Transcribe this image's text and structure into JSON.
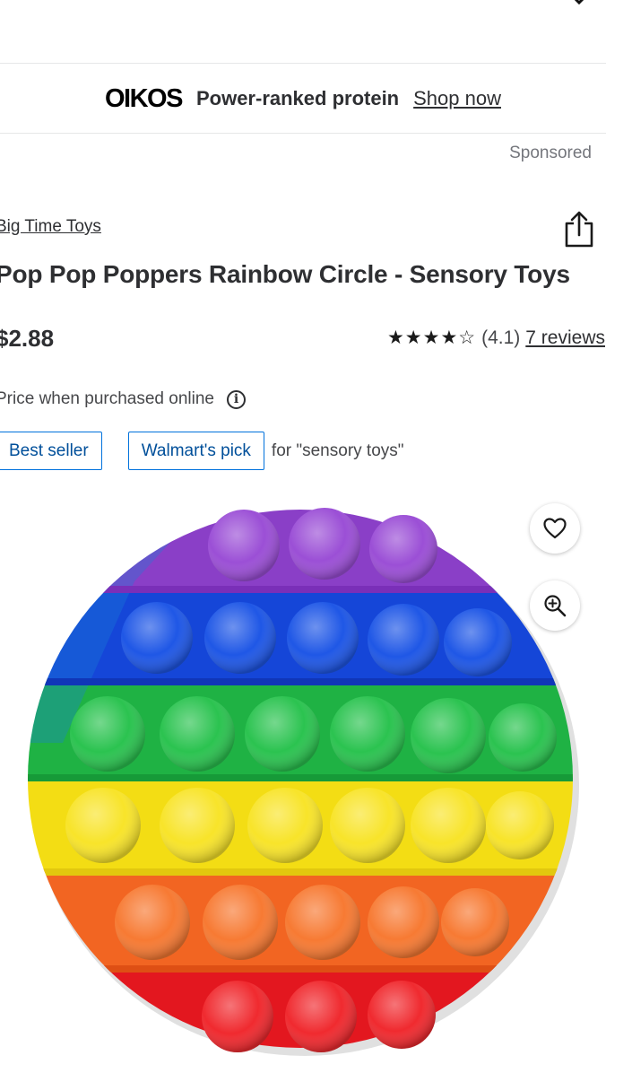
{
  "ad": {
    "brand": "OIKOS",
    "tagline": "Power-ranked protein",
    "cta": "Shop now",
    "sponsored_label": "Sponsored"
  },
  "product": {
    "brand": "Big Time Toys",
    "title": "Pop Pop Poppers Rainbow Circle - Sensory Toys",
    "price": "$2.88",
    "price_note": "Price when purchased online",
    "rating": {
      "value": 4.1,
      "stars_filled": 4,
      "stars_total": 5,
      "label": "(4.1)",
      "reviews_label": "7 reviews"
    },
    "badges": {
      "best_seller": "Best seller",
      "pick": "Walmart's pick",
      "context": "for \"sensory toys\""
    }
  },
  "icons": {
    "close": "close-icon",
    "share": "share-icon",
    "info": "info-icon",
    "favorite": "heart-icon",
    "zoom": "zoom-in-icon"
  },
  "colors": {
    "text": "#2e2f32",
    "badge_blue": "#0071dc",
    "rainbow": [
      "#8a3fc7",
      "#1546d8",
      "#1fb244",
      "#f3dd14",
      "#f26522",
      "#e3171f"
    ]
  }
}
